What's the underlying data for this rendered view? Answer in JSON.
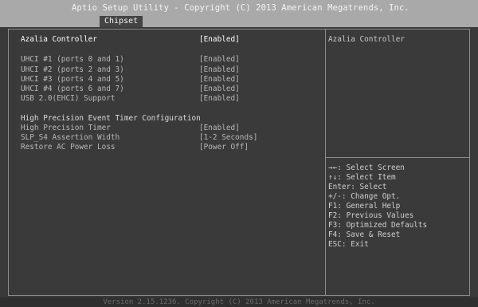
{
  "header": {
    "title": "Aptio Setup Utility - Copyright (C) 2013 American Megatrends, Inc.",
    "active_tab": "Chipset"
  },
  "settings": [
    {
      "label": "Azalia Controller",
      "value": "[Enabled]"
    },
    {
      "label": "UHCI #1 (ports 0 and 1)",
      "value": "[Enabled]"
    },
    {
      "label": "UHCI #2 (ports 2 and 3)",
      "value": "[Enabled]"
    },
    {
      "label": "UHCI #3 (ports 4 and 5)",
      "value": "[Enabled]"
    },
    {
      "label": "UHCI #4 (ports 6 and 7)",
      "value": "[Enabled]"
    },
    {
      "label": "USB 2.0(EHCI) Support",
      "value": "[Enabled]"
    },
    {
      "label": "High Precision Event Timer Configuration",
      "value": ""
    },
    {
      "label": "High Precision Timer",
      "value": "[Enabled]"
    },
    {
      "label": "SLP_S4 Assertion Width",
      "value": "[1-2 Seconds]"
    },
    {
      "label": "Restore AC Power Loss",
      "value": "[Power Off]"
    }
  ],
  "help": {
    "title": "Azalia Controller",
    "keys": [
      "→←: Select Screen",
      "↑↓: Select Item",
      "Enter: Select",
      "+/-: Change Opt.",
      "F1: General Help",
      "F2: Previous Values",
      "F3: Optimized Defaults",
      "F4: Save & Reset",
      "ESC: Exit"
    ]
  },
  "footer": {
    "text": "Version 2.15.1236. Copyright (C) 2013 American Megatrends, Inc."
  }
}
